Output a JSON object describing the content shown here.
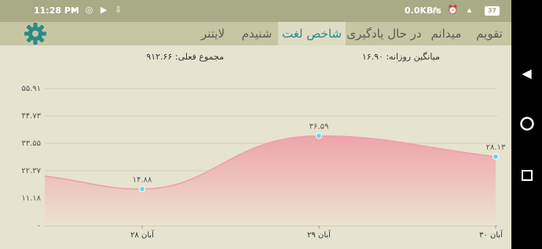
{
  "status_bar": {
    "time": "11:28 PM",
    "net_speed": "0.0KB/s",
    "battery": "37"
  },
  "tabs": [
    {
      "label": "تقویم",
      "active": false
    },
    {
      "label": "میدانم",
      "active": false
    },
    {
      "label": "در حال یادگیری",
      "active": false
    },
    {
      "label": "شاخص لغت",
      "active": true
    },
    {
      "label": "شنیدم",
      "active": false
    },
    {
      "label": "لایتنر",
      "active": false
    }
  ],
  "summary": {
    "daily_average": "میانگین روزانه: ۱۶.۹۰",
    "current_total": "مجموع فعلی: ۹۱۲.۶۶"
  },
  "chart_data": {
    "type": "area",
    "y_tick_labels": [
      "۰",
      "۱۱.۱۸",
      "۲۲.۳۷",
      "۳۳.۵۵",
      "۴۴.۷۳",
      "۵۵.۹۱"
    ],
    "y_ticks": [
      0,
      11.18,
      22.37,
      33.55,
      44.73,
      55.91
    ],
    "ylim": [
      0,
      55.91
    ],
    "categories": [
      "۲۸ آبان",
      "۲۹ آبان",
      "۳۰ آبان"
    ],
    "x": [
      1,
      2,
      3
    ],
    "values": [
      14.88,
      36.59,
      28.13
    ],
    "value_labels": [
      "۱۴.۸۸",
      "۳۶.۵۹",
      "۲۸.۱۳"
    ],
    "fill_color_top": "#efa3ab",
    "fill_color_bottom": "#ece3cf",
    "line_color": "#eea0a8",
    "point_color": "#6fd3ef",
    "grid": "horizontal"
  },
  "colors": {
    "accent": "#2a8a86",
    "status_bar": "#a9ab87",
    "tab_bar": "#c6c6a4",
    "background": "#e6e3cf"
  },
  "icons": {
    "settings": "gear-icon",
    "back": "back-triangle-icon",
    "home": "home-circle-icon",
    "recents": "recents-square-icon"
  }
}
